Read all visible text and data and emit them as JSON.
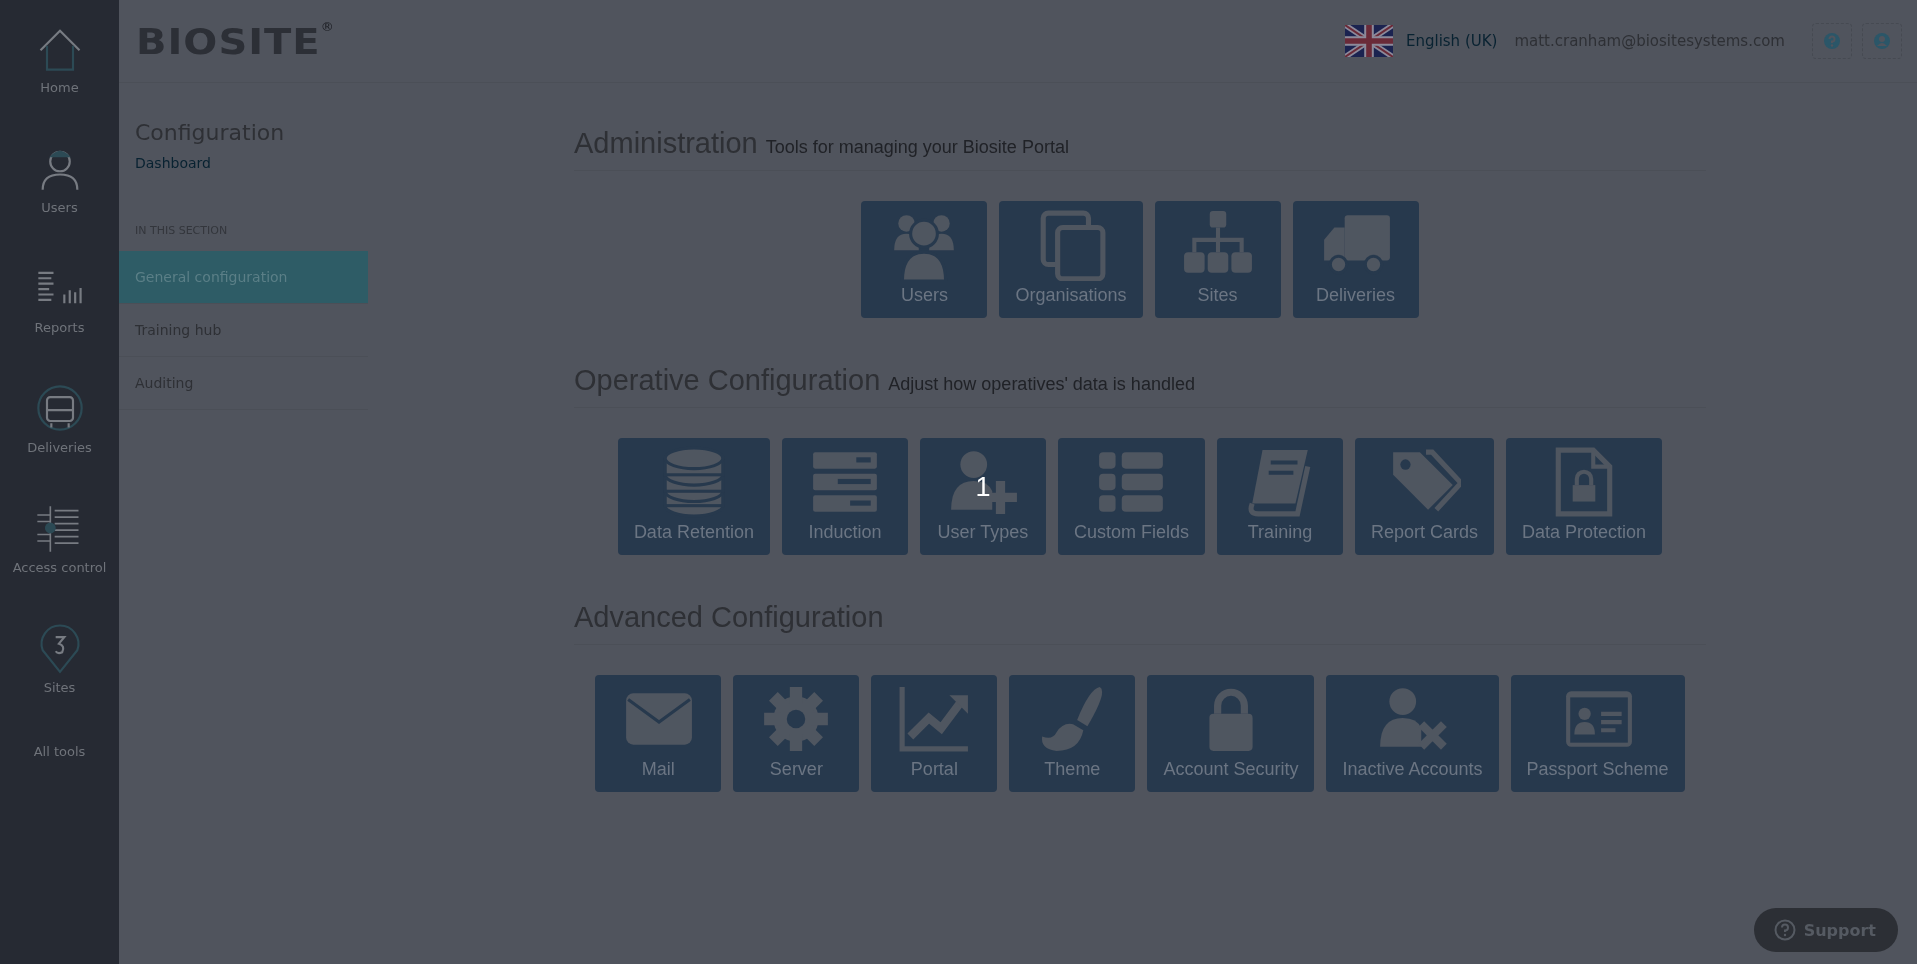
{
  "rail": [
    {
      "label": "Home"
    },
    {
      "label": "Users"
    },
    {
      "label": "Reports"
    },
    {
      "label": "Deliveries"
    },
    {
      "label": "Access control"
    },
    {
      "label": "Sites"
    }
  ],
  "rail_footer": "All tools",
  "header": {
    "logo": "BIOSITE",
    "logo_mark": "®",
    "language": "English (UK)",
    "email": "matt.cranham@biositesystems.com"
  },
  "config_panel": {
    "title": "Configuration",
    "breadcrumb": "Dashboard",
    "section_label": "IN THIS SECTION",
    "items": [
      {
        "label": "General configuration",
        "selected": true
      },
      {
        "label": "Training hub",
        "selected": false
      },
      {
        "label": "Auditing",
        "selected": false
      }
    ]
  },
  "sections": [
    {
      "title": "Administration",
      "subtitle": "Tools for managing your Biosite Portal",
      "tiles": [
        {
          "label": "Users"
        },
        {
          "label": "Organisations"
        },
        {
          "label": "Sites"
        },
        {
          "label": "Deliveries"
        }
      ]
    },
    {
      "title": "Operative Configuration",
      "subtitle": "Adjust how operatives' data is handled",
      "tiles": [
        {
          "label": "Data Retention"
        },
        {
          "label": "Induction"
        },
        {
          "label": "User Types",
          "step_marker": "1"
        },
        {
          "label": "Custom Fields"
        },
        {
          "label": "Training"
        },
        {
          "label": "Report Cards"
        },
        {
          "label": "Data Protection"
        }
      ]
    },
    {
      "title": "Advanced Configuration",
      "tiles": [
        {
          "label": "Mail"
        },
        {
          "label": "Server"
        },
        {
          "label": "Portal"
        },
        {
          "label": "Theme"
        },
        {
          "label": "Account Security"
        },
        {
          "label": "Inactive Accounts"
        },
        {
          "label": "Passport Scheme"
        }
      ]
    }
  ],
  "support_button": "Support"
}
